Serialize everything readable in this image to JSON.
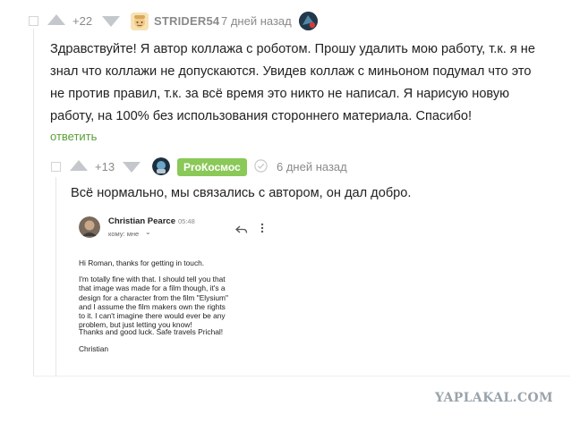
{
  "comment1": {
    "score": "+22",
    "author": "STRIDER54",
    "time": "7 дней назад",
    "text": "Здравствуйте! Я автор коллажа с роботом. Прошу удалить мою работу, т.к. я не знал что коллажи не допускаются. Увидев коллаж с миньоном подумал что это не против правил, т.к. за всё время это никто не написал. Я нарисую новую работу, на 100% без использования стороннего материала. Спасибо!",
    "reply_label": "ответить"
  },
  "comment2": {
    "score": "+13",
    "author": "ProКосмос",
    "time": "6 дней назад",
    "text": "Всё нормально, мы связались с автором, он дал добро."
  },
  "email": {
    "sender": "Christian Pearce",
    "time": "05:48",
    "to_label": "кому: мне",
    "greeting": "Hi Roman, thanks for getting in touch.",
    "paragraph": "I'm totally fine with that. I should tell you that that image was made for a film though, it's a design for a character from the film \"Elysium\" and I assume the film makers own the rights to it. I can't imagine there would ever be any problem, but just letting you know!",
    "thanks": "Thanks and good luck. Safe travels Prichal!",
    "signature": "Christian"
  },
  "watermark": "YAPLAKAL.COM",
  "colors": {
    "accent_green": "#5a9f3a",
    "badge_green": "#8ac858",
    "arrow_gray": "#c4c7cc",
    "meta_gray": "#8a8a8a"
  }
}
